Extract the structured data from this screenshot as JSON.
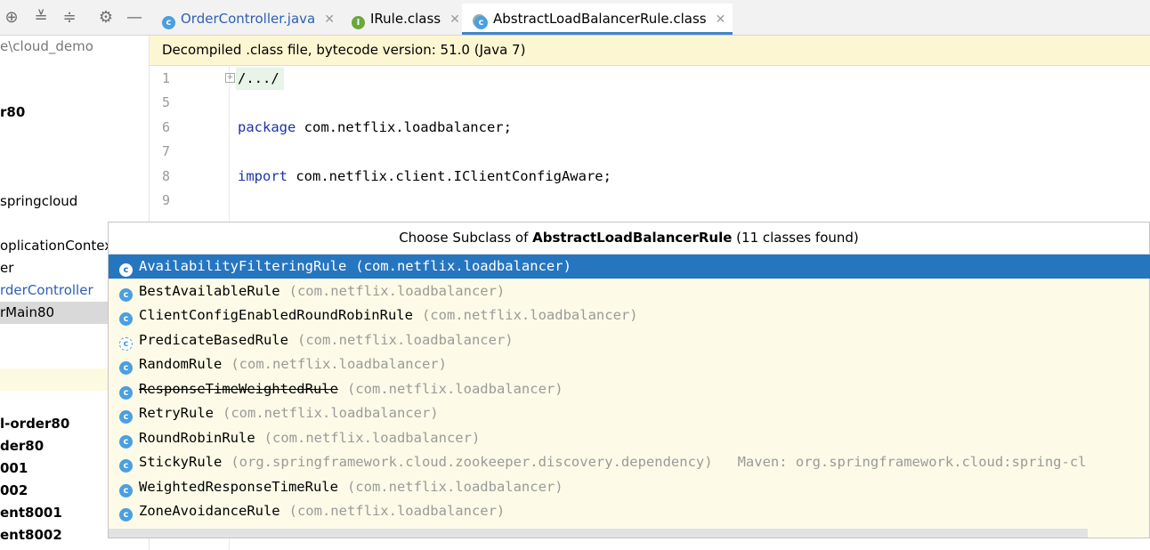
{
  "toolbar": {
    "icons": [
      "crosshair-icon",
      "expand-all-icon",
      "collapse-all-icon",
      "gear-icon",
      "minimize-icon"
    ]
  },
  "project_tree": {
    "rows": [
      {
        "label": "e\\cloud_demo",
        "style": "gray"
      },
      {
        "label": "r80",
        "style": "bold"
      },
      {
        "label": "springcloud",
        "style": ""
      },
      {
        "label": "oplicationContex",
        "style": ""
      },
      {
        "label": "er",
        "style": ""
      },
      {
        "label": "rderController",
        "style": "blue"
      },
      {
        "label": "rMain80",
        "style": "selected"
      },
      {
        "label": "l-order80",
        "style": "bold"
      },
      {
        "label": "der80",
        "style": "bold"
      },
      {
        "label": "001",
        "style": "bold"
      },
      {
        "label": "002",
        "style": "bold"
      },
      {
        "label": "ent8001",
        "style": "bold"
      },
      {
        "label": "ent8002",
        "style": "bold"
      }
    ]
  },
  "tabs": [
    {
      "label": "OrderController.java",
      "icon": "class-icon",
      "active": false
    },
    {
      "label": "IRule.class",
      "icon": "interface-icon",
      "active": false
    },
    {
      "label": "AbstractLoadBalancerRule.class",
      "icon": "library-class-icon",
      "active": true
    }
  ],
  "banner": {
    "text": "Decompiled .class file, bytecode version: 51.0 (Java 7)"
  },
  "editor": {
    "line_numbers": [
      "1",
      "5",
      "6",
      "7",
      "8",
      "9"
    ],
    "fold_text": "/.../",
    "package_kw": "package",
    "package_name": " com.netflix.loadbalancer;",
    "import_kw": "import",
    "import_name": " com.netflix.client.IClientConfigAware;"
  },
  "popup": {
    "title_prefix": "Choose Subclass of ",
    "title_class": "AbstractLoadBalancerRule",
    "title_suffix": " (11 classes found)",
    "items": [
      {
        "name": "AvailabilityFilteringRule",
        "pkg": "(com.netflix.loadbalancer)",
        "selected": true
      },
      {
        "name": "BestAvailableRule",
        "pkg": "(com.netflix.loadbalancer)"
      },
      {
        "name": "ClientConfigEnabledRoundRobinRule",
        "pkg": "(com.netflix.loadbalancer)"
      },
      {
        "name": "PredicateBasedRule",
        "pkg": "(com.netflix.loadbalancer)",
        "abstract": true
      },
      {
        "name": "RandomRule",
        "pkg": "(com.netflix.loadbalancer)"
      },
      {
        "name": "ResponseTimeWeightedRule",
        "pkg": "(com.netflix.loadbalancer)",
        "deprecated": true
      },
      {
        "name": "RetryRule",
        "pkg": "(com.netflix.loadbalancer)"
      },
      {
        "name": "RoundRobinRule",
        "pkg": "(com.netflix.loadbalancer)"
      },
      {
        "name": "StickyRule",
        "pkg": "(org.springframework.cloud.zookeeper.discovery.dependency)",
        "maven": "Maven: org.springframework.cloud:spring-cl"
      },
      {
        "name": "WeightedResponseTimeRule",
        "pkg": "(com.netflix.loadbalancer)"
      },
      {
        "name": "ZoneAvoidanceRule",
        "pkg": "(com.netflix.loadbalancer)"
      }
    ]
  }
}
